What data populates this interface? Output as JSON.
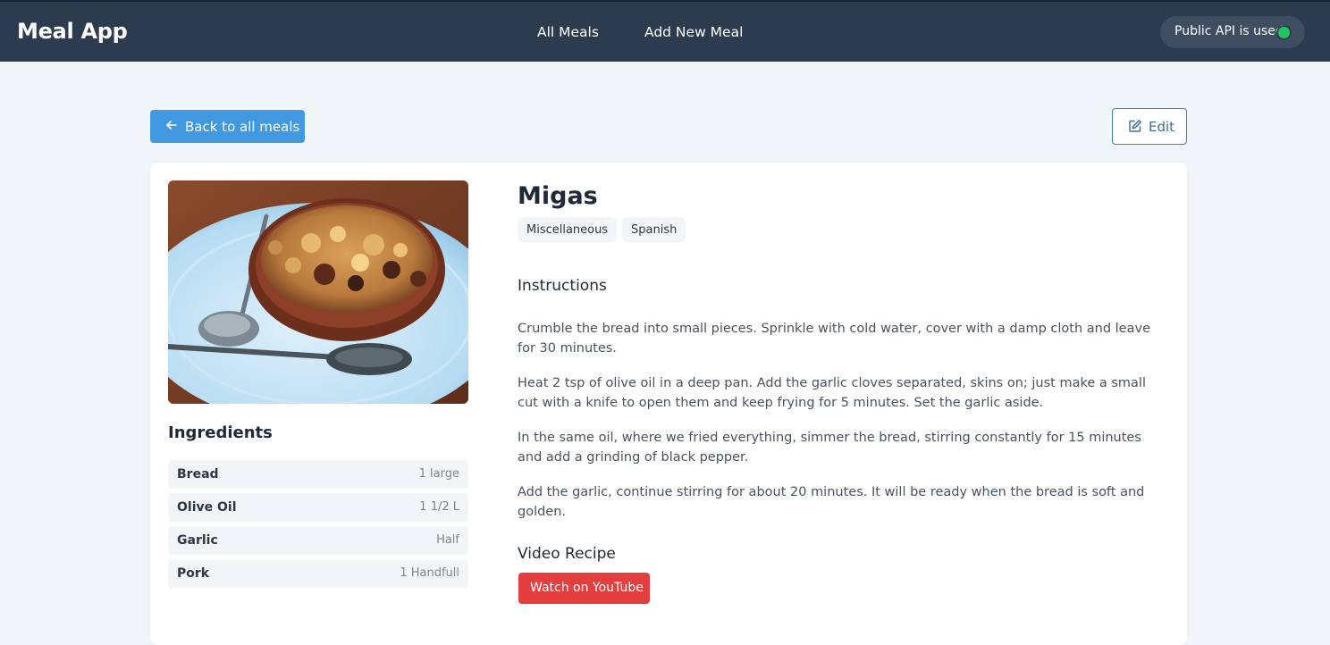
{
  "navbar": {
    "brand": "Meal App",
    "links": [
      "All Meals",
      "Add New Meal"
    ],
    "api_status": "Public API is used",
    "status_color": "#22c55e"
  },
  "actions": {
    "back_label": "Back to all meals",
    "edit_label": "Edit"
  },
  "meal": {
    "name": "Migas",
    "tags": [
      "Miscellaneous",
      "Spanish"
    ],
    "ingredients_title": "Ingredients",
    "ingredients": [
      {
        "name": "Bread",
        "measure": "1 large"
      },
      {
        "name": "Olive Oil",
        "measure": "1 1/2 L"
      },
      {
        "name": "Garlic",
        "measure": "Half"
      },
      {
        "name": "Pork",
        "measure": "1 Handfull"
      }
    ],
    "instructions_title": "Instructions",
    "instructions": [
      "Crumble the bread into small pieces. Sprinkle with cold water, cover with a damp cloth and leave for 30 minutes.",
      "Heat 2 tsp of olive oil in a deep pan. Add the garlic cloves separated, skins on; just make a small cut with a knife to open them and keep frying for 5 minutes. Set the garlic aside.",
      "In the same oil, where we fried everything, simmer the bread, stirring constantly for 15 minutes and add a grinding of black pepper.",
      "Add the garlic, continue stirring for about 20 minutes. It will be ready when the bread is soft and golden."
    ],
    "video_title": "Video Recipe",
    "video_button": "Watch on YouTube"
  },
  "colors": {
    "navbar_bg": "#2d3b4f",
    "primary": "#4299e1",
    "danger": "#e53e3e"
  }
}
